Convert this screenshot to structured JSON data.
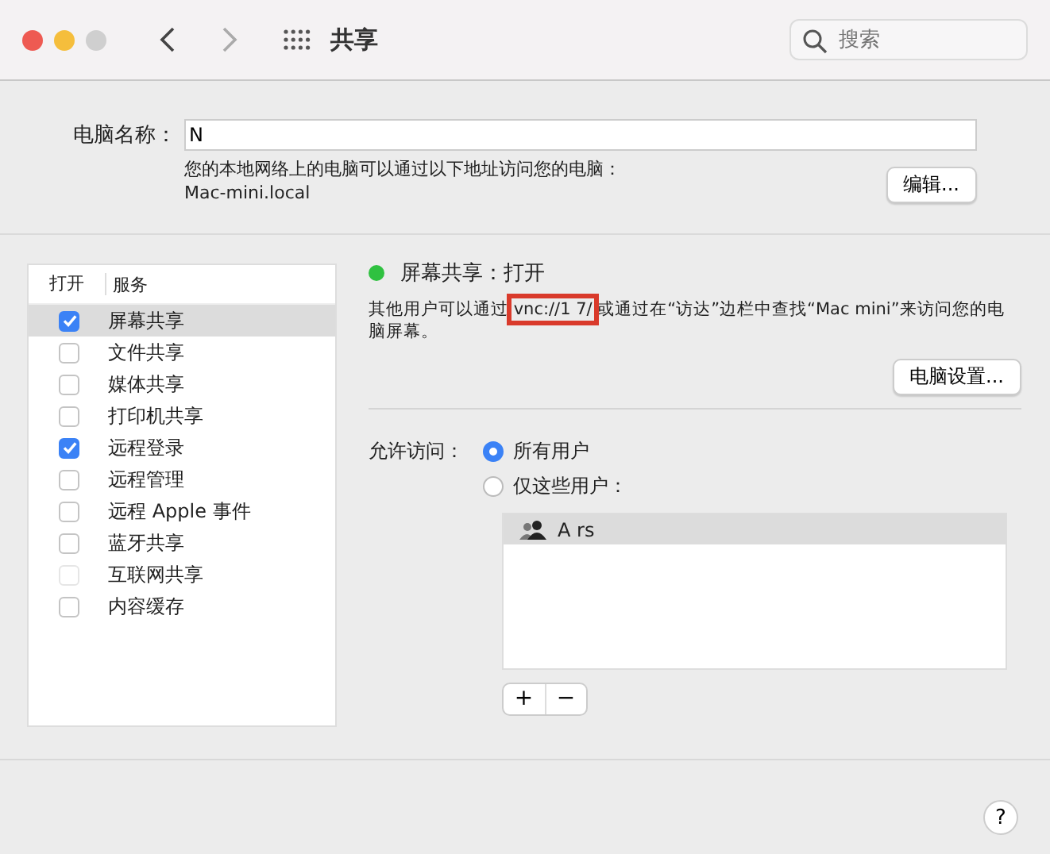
{
  "window": {
    "title": "共享"
  },
  "search": {
    "placeholder": "搜索"
  },
  "computer_name": {
    "label": "电脑名称：",
    "value": "N",
    "hint": "您的本地网络上的电脑可以通过以下地址访问您的电脑：",
    "address": "Mac-mini.local",
    "edit_button": "编辑..."
  },
  "services": {
    "columns": [
      "打开",
      "服务"
    ],
    "rows": [
      {
        "label": "屏幕共享",
        "checked": true,
        "selected": true,
        "disabled": false
      },
      {
        "label": "文件共享",
        "checked": false,
        "selected": false,
        "disabled": false
      },
      {
        "label": "媒体共享",
        "checked": false,
        "selected": false,
        "disabled": false
      },
      {
        "label": "打印机共享",
        "checked": false,
        "selected": false,
        "disabled": false
      },
      {
        "label": "远程登录",
        "checked": true,
        "selected": false,
        "disabled": false
      },
      {
        "label": "远程管理",
        "checked": false,
        "selected": false,
        "disabled": false
      },
      {
        "label": "远程 Apple 事件",
        "checked": false,
        "selected": false,
        "disabled": false
      },
      {
        "label": "蓝牙共享",
        "checked": false,
        "selected": false,
        "disabled": false
      },
      {
        "label": "互联网共享",
        "checked": false,
        "selected": false,
        "disabled": true
      },
      {
        "label": "内容缓存",
        "checked": false,
        "selected": false,
        "disabled": false
      }
    ]
  },
  "detail": {
    "status": "屏幕共享：打开",
    "status_on": true,
    "desc_before": "其他用户可以通过",
    "vnc": "vnc://1 7/",
    "desc_after": "或通过在“访达”边栏中查找“Mac mini”来访问您的电脑屏幕。",
    "settings_button": "电脑设置...",
    "access_label": "允许访问：",
    "options": [
      {
        "label": "所有用户",
        "selected": true
      },
      {
        "label": "仅这些用户：",
        "selected": false
      }
    ],
    "users": [
      {
        "name": "A rs",
        "selected": true
      }
    ],
    "add": "+",
    "remove": "−"
  },
  "help": "?"
}
